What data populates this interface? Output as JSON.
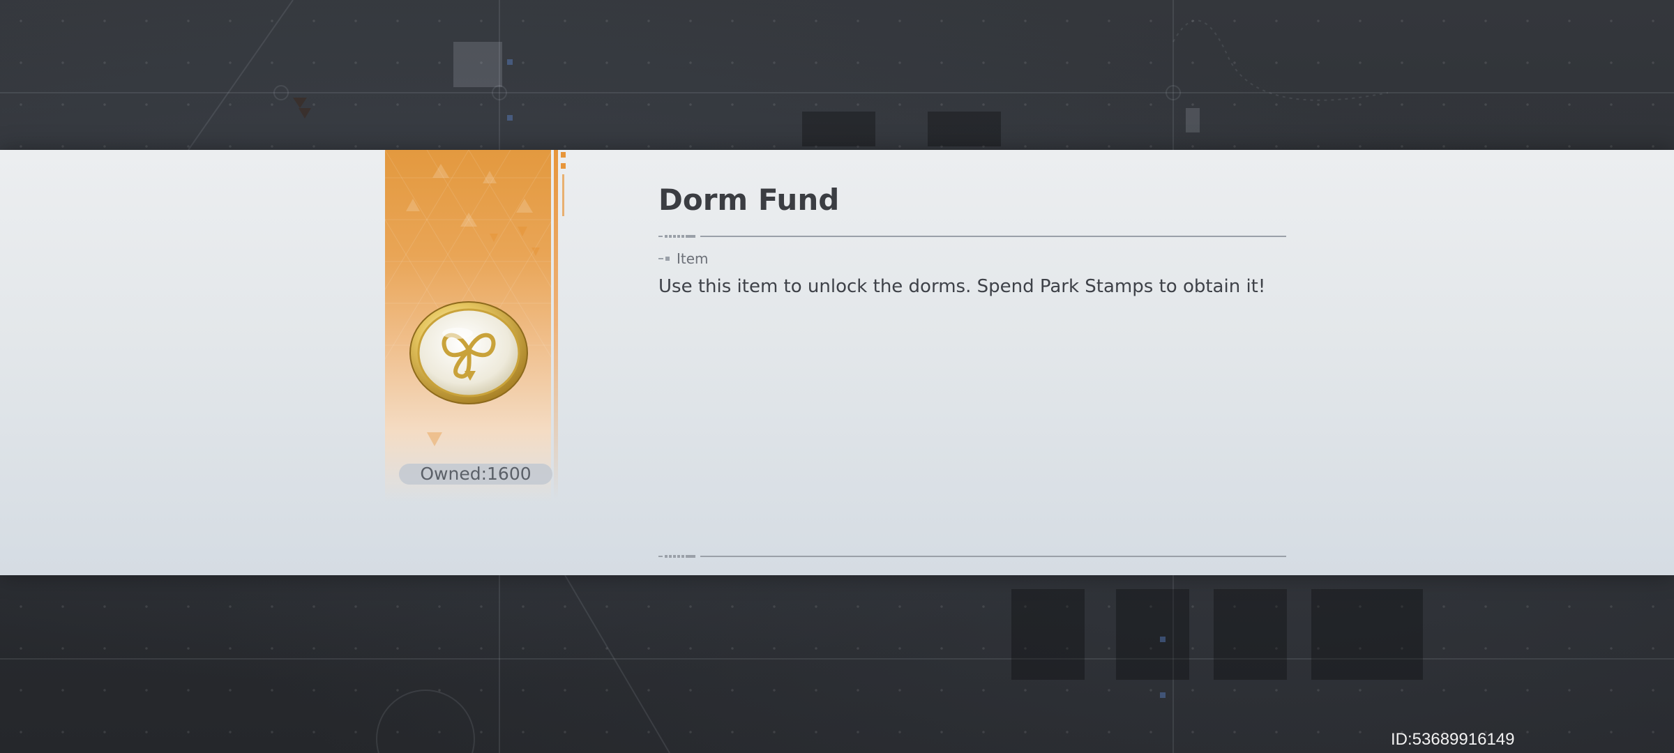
{
  "item": {
    "title": "Dorm Fund",
    "category": "Item",
    "description": "Use this item to unlock the dorms. Spend Park Stamps to obtain it!",
    "owned_text": "Owned:1600",
    "icon": "clover-coin-icon"
  },
  "footer": {
    "uid_text": "ID:53689916149"
  },
  "colors": {
    "card_accent": "#e3993f",
    "band_background": "#eceef0",
    "title_text": "#3b3d42",
    "scene_background": "#2a2d31"
  }
}
